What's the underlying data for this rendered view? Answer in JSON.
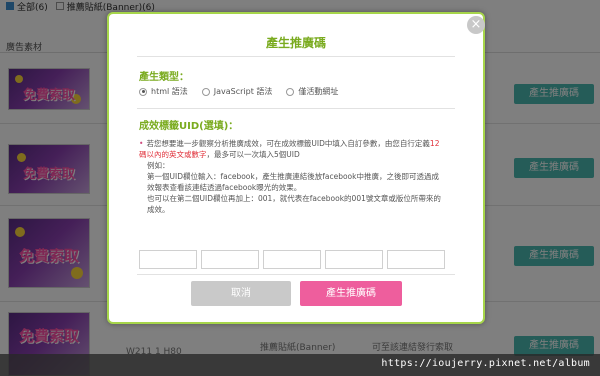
{
  "background": {
    "filters": [
      {
        "label": "全部(6)",
        "checked": true
      },
      {
        "label": "推薦貼紙(Banner)(6)",
        "checked": false
      }
    ],
    "section_header": "廣告素材",
    "thumbnail_text": "免費索取",
    "row_button_label": "產生推廣碼",
    "bottom_text_left": "W211 1 H80",
    "bottom_text_mid": "推薦貼紙(Banner)",
    "bottom_text_right": "可至該連結發行索取"
  },
  "modal": {
    "title": "產生推廣碼",
    "close_icon": "close-icon",
    "type_label": "產生類型：",
    "type_options": [
      {
        "label": "html 語法",
        "selected": true
      },
      {
        "label": "JavaScript 語法",
        "selected": false
      },
      {
        "label": "僅活動網址",
        "selected": false
      }
    ],
    "uid_label": "成效標籤UID(選填)：",
    "desc_part1": "若您想要進一步觀察分析推廣成效，可在成效標籤UID中填入自訂參數，由您自行定義",
    "desc_red": "12碼以內的英文或數字",
    "desc_part2": "，最多可以一次填入5個UID",
    "desc_example_head": "例如：",
    "desc_example_1": "第一個UID欄位輸入：facebook，產生推廣連結後放facebook中推廣，之後即可透過成效報表查看該連結透過facebook曝光的效果。",
    "desc_example_2": "也可以在第二個UID欄位再加上：001，就代表在facebook的001號文章或版位所帶來的成效。",
    "uid_inputs": [
      "",
      "",
      "",
      "",
      ""
    ],
    "cancel_label": "取消",
    "generate_label": "產生推廣碼"
  },
  "watermark": "https://ioujerry.pixnet.net/album",
  "colors": {
    "accent_green": "#7aab1f",
    "modal_border": "#a6d54a",
    "generate_pink": "#ee5e9d",
    "cancel_gray": "#c9c9c9",
    "row_button_teal": "#4bb8b0"
  }
}
